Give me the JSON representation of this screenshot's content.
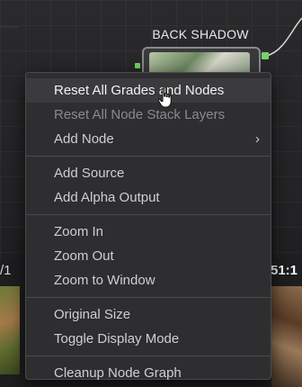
{
  "node": {
    "label": "BACK SHADOW"
  },
  "viewer": {
    "left_fragment": "/1",
    "right_fragment": "51:1",
    "bottom_fragment": "..."
  },
  "context_menu": {
    "groups": [
      [
        {
          "label": "Reset All Grades and Nodes",
          "state": "highlighted",
          "submenu": false
        },
        {
          "label": "Reset All Node Stack Layers",
          "state": "disabled",
          "submenu": false
        },
        {
          "label": "Add Node",
          "state": "normal",
          "submenu": true
        }
      ],
      [
        {
          "label": "Add Source",
          "state": "normal",
          "submenu": false
        },
        {
          "label": "Add Alpha Output",
          "state": "normal",
          "submenu": false
        }
      ],
      [
        {
          "label": "Zoom In",
          "state": "normal",
          "submenu": false
        },
        {
          "label": "Zoom Out",
          "state": "normal",
          "submenu": false
        },
        {
          "label": "Zoom to Window",
          "state": "normal",
          "submenu": false
        }
      ],
      [
        {
          "label": "Original Size",
          "state": "normal",
          "submenu": false
        },
        {
          "label": "Toggle Display Mode",
          "state": "normal",
          "submenu": false
        }
      ],
      [
        {
          "label": "Cleanup Node Graph",
          "state": "normal",
          "submenu": false
        }
      ]
    ],
    "submenu_glyph": "›"
  },
  "colors": {
    "node_port": "#79d36a",
    "menu_bg": "#2e2e30",
    "menu_text": "#cfcfd1",
    "menu_disabled": "#8a8a8c"
  },
  "icons": {
    "cursor": "pointer-hand-icon",
    "submenu": "chevron-right-icon"
  }
}
